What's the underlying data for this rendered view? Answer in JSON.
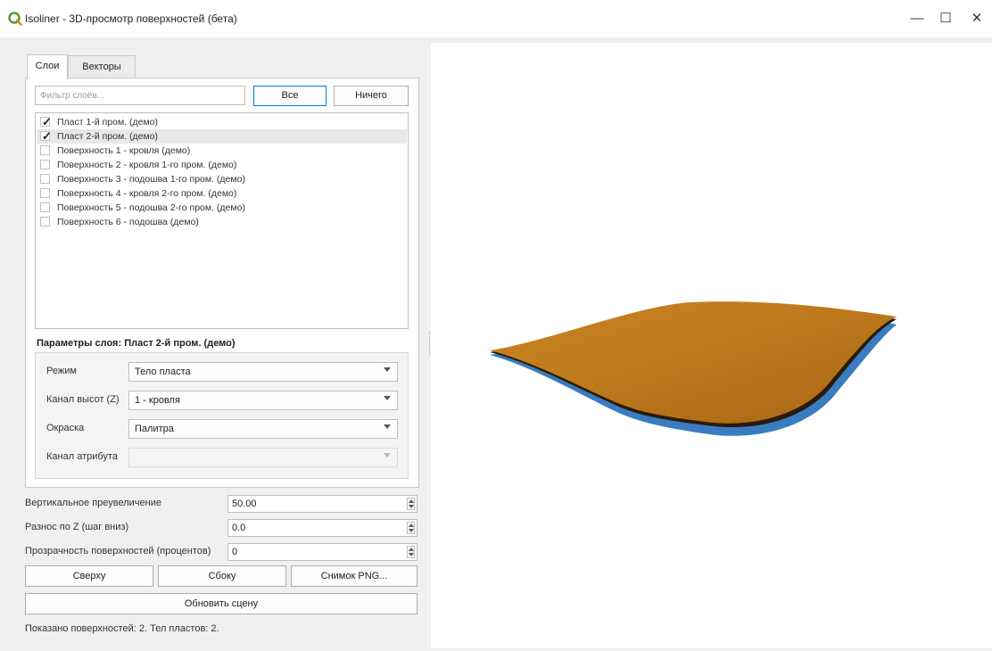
{
  "window": {
    "title": "Isoliner - 3D-просмотр поверхностей (бета)",
    "minimize": "—",
    "maximize": "☐",
    "close": "✕"
  },
  "tabs": [
    {
      "label": "Слои",
      "active": true
    },
    {
      "label": "Векторы",
      "active": false
    }
  ],
  "filter": {
    "placeholder": "Фильтр слоёв...",
    "value": ""
  },
  "buttons": {
    "all": "Все",
    "none": "Ничего"
  },
  "layers": [
    {
      "label": "Пласт 1-й пром. (демо)",
      "checked": true
    },
    {
      "label": "Пласт 2-й пром. (демо)",
      "checked": true,
      "selected": true
    },
    {
      "label": "Поверхность 1 - кровля (демо)",
      "checked": false
    },
    {
      "label": "Поверхность 2 - кровля 1-го пром. (демо)",
      "checked": false
    },
    {
      "label": "Поверхность 3 - подошва 1-го пром. (демо)",
      "checked": false
    },
    {
      "label": "Поверхность 4 - кровля 2-го пром. (демо)",
      "checked": false
    },
    {
      "label": "Поверхность 5 - подошва 2-го пром. (демо)",
      "checked": false
    },
    {
      "label": "Поверхность 6 - подошва (демо)",
      "checked": false
    }
  ],
  "params": {
    "title": "Параметры слоя: Пласт 2-й пром. (демо)",
    "mode": {
      "label": "Режим",
      "value": "Тело пласта"
    },
    "z_channel": {
      "label": "Канал высот (Z)",
      "value": "1 - кровля"
    },
    "coloring": {
      "label": "Окраска",
      "value": "Палитра"
    },
    "attr_channel": {
      "label": "Канал атрибута",
      "value": ""
    }
  },
  "settings": {
    "vert_exag": {
      "label": "Вертикальное преувеличение",
      "value": "50.00"
    },
    "z_offset": {
      "label": "Разнос по Z (шаг вниз)",
      "value": "0.0"
    },
    "transparency": {
      "label": "Прозрачность поверхностей (процентов)",
      "value": "0"
    }
  },
  "actions": {
    "top": "Сверху",
    "side": "Сбоку",
    "snapshot": "Снимок PNG...",
    "refresh": "Обновить сцену"
  },
  "status": "Показано поверхностей: 2. Тел пластов: 2.",
  "colors": {
    "surface_top": "#c07a1e",
    "surface_side": "#3a7cc0",
    "accent": "#0078d7"
  }
}
